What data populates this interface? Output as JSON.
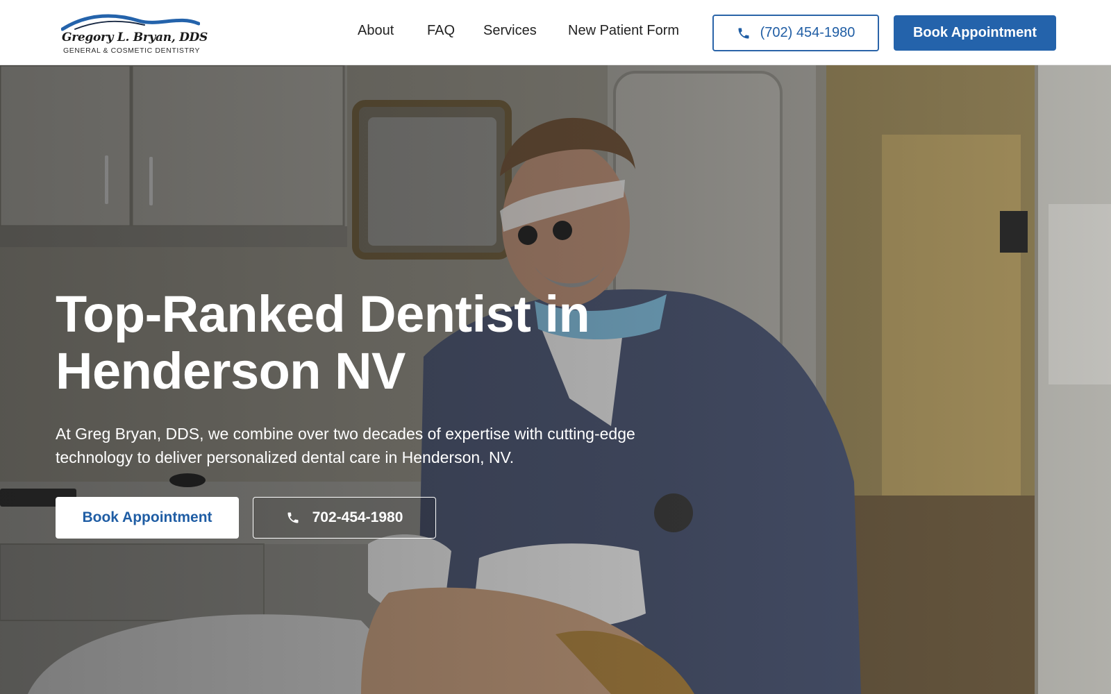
{
  "header": {
    "logo": {
      "name": "Gregory L. Bryan, DDS",
      "tagline": "GENERAL & COSMETIC DENTISTRY"
    },
    "nav": [
      {
        "label": "About"
      },
      {
        "label": "FAQ"
      },
      {
        "label": "Services"
      },
      {
        "label": "New Patient Form"
      }
    ],
    "phone_label": "(702) 454-1980",
    "book_label": "Book Appointment"
  },
  "hero": {
    "title_line1": "Top-Ranked Dentist in",
    "title_line2": "Henderson NV",
    "subtitle_line1": "At Greg Bryan, DDS, we combine over two decades of expertise with cutting-edge",
    "subtitle_line2": "technology to deliver personalized dental care in Henderson, NV.",
    "book_label": "Book Appointment",
    "phone_label": "702-454-1980"
  },
  "icons": {
    "phone": "phone-icon"
  },
  "colors": {
    "brand_blue": "#2463ab",
    "text_dark": "#222222",
    "white": "#ffffff"
  }
}
